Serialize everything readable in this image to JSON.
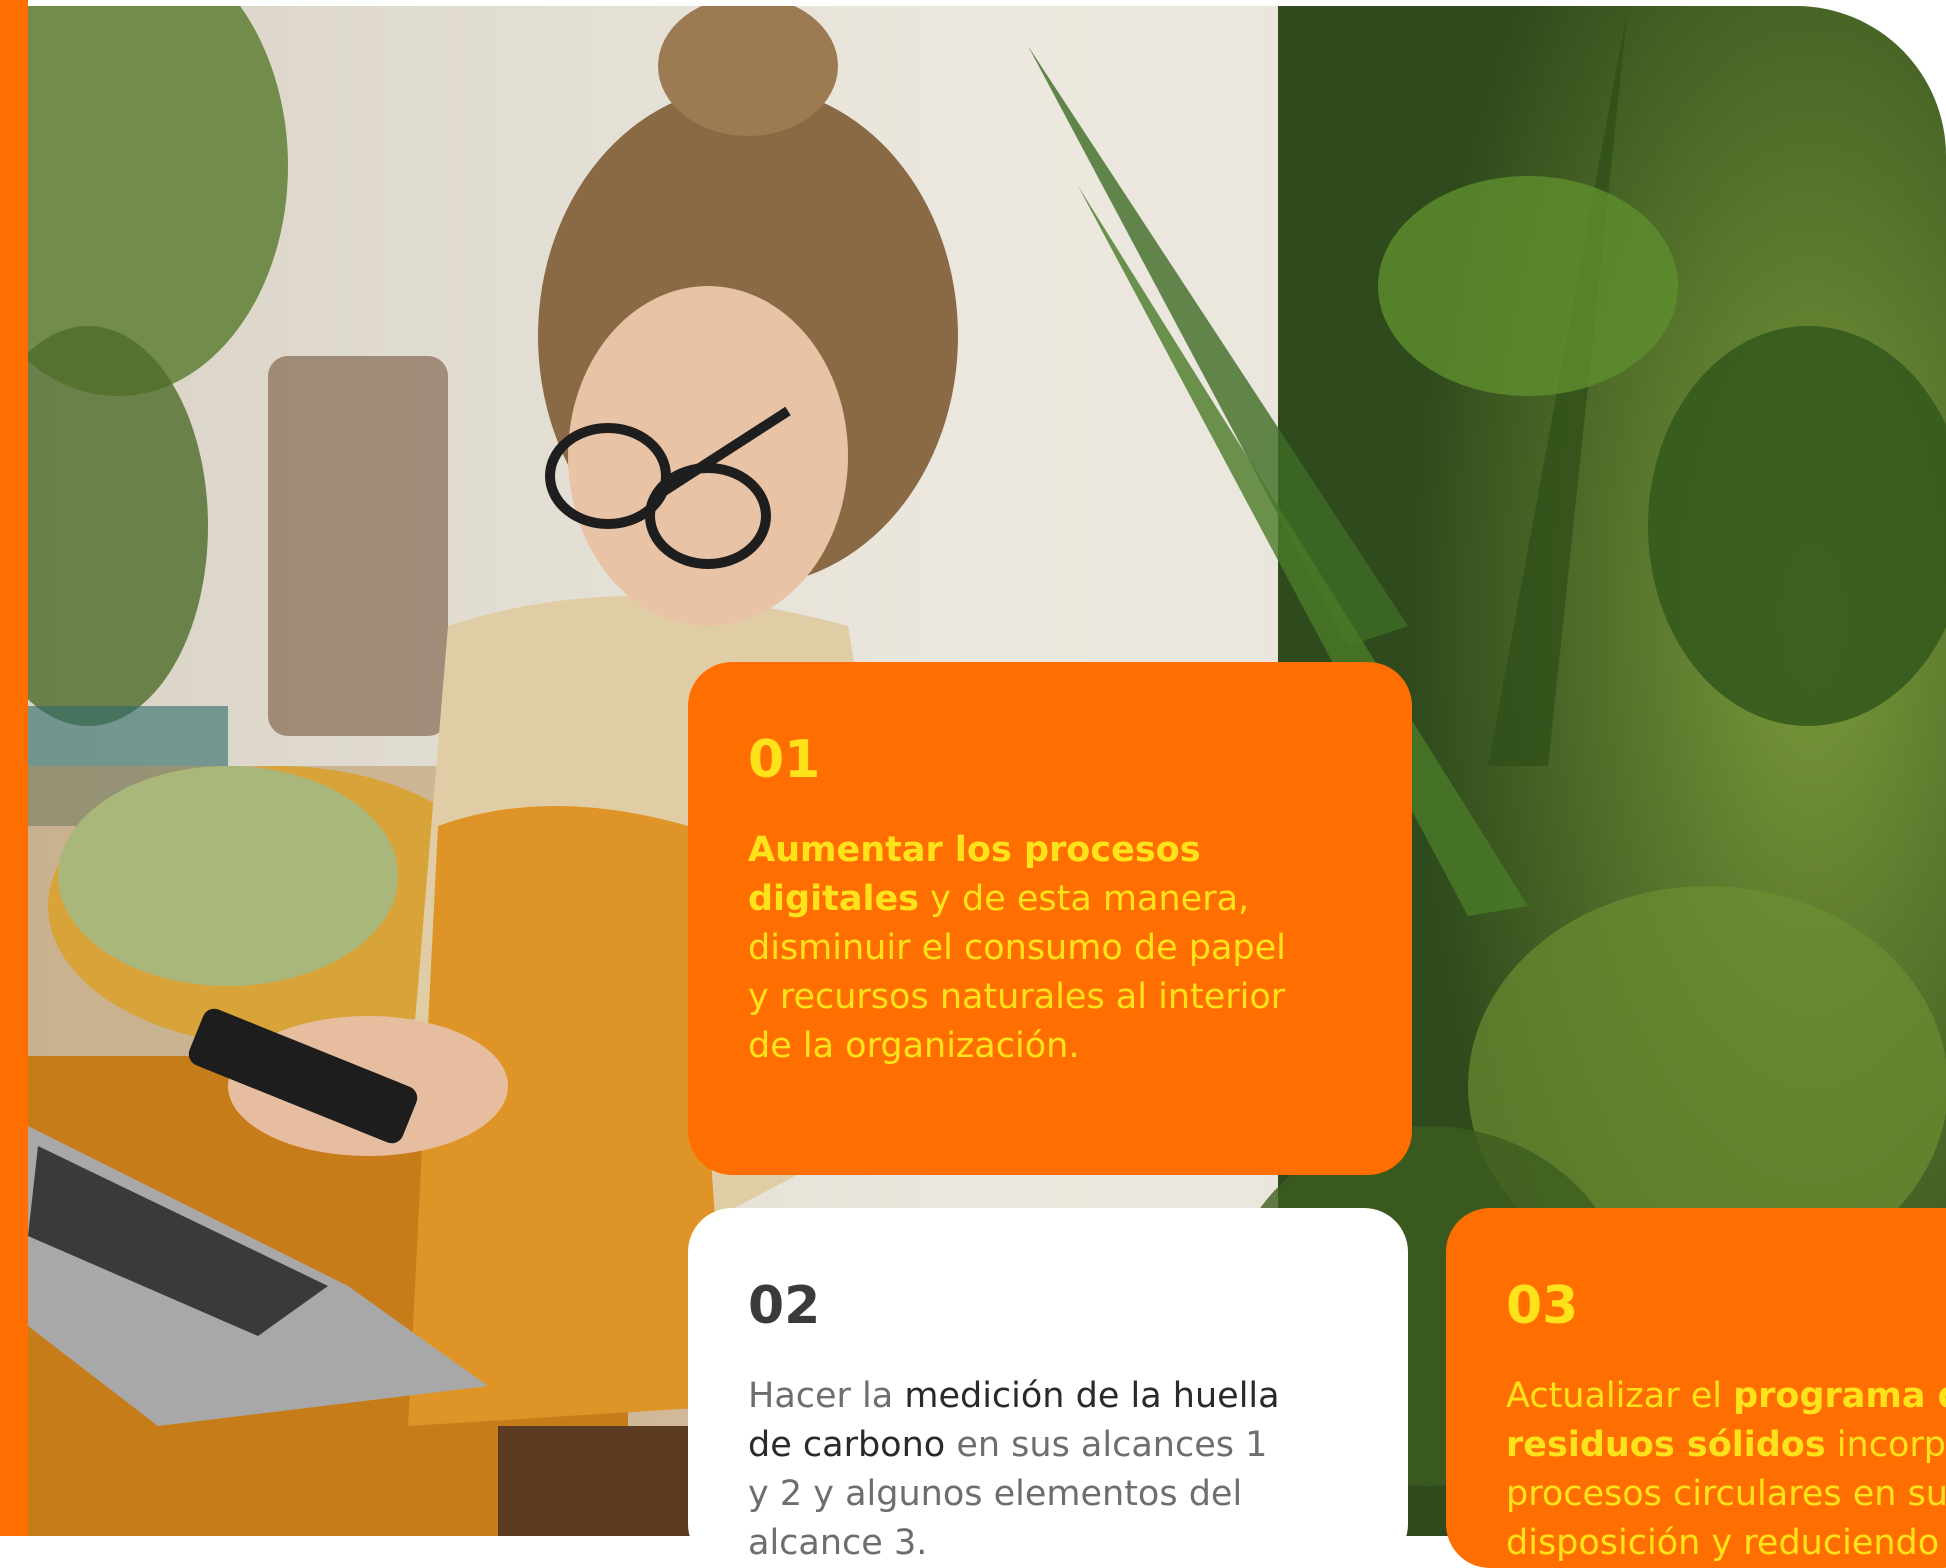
{
  "colors": {
    "accent_orange": "#FF6E00",
    "highlight_yellow": "#FFE31A",
    "card_white": "#FFFFFF",
    "dark_text": "#3A3A3A",
    "grey_text": "#6E6E6E"
  },
  "photo": {
    "subject": "woman-with-glasses-using-phone-and-laptop-among-plants"
  },
  "cards": [
    {
      "number": "01",
      "lines": [
        {
          "bold": "Aumentar los procesos",
          "rest": ""
        },
        {
          "bold": "digitales",
          "rest": " y de esta manera,"
        },
        {
          "bold": "",
          "rest": "disminuir el consumo de papel"
        },
        {
          "bold": "",
          "rest": "y recursos naturales al interior"
        },
        {
          "bold": "",
          "rest": "de la organización."
        }
      ]
    },
    {
      "number": "02",
      "lines": [
        {
          "pre": "Hacer la ",
          "bold": "medición de la huella",
          "rest": ""
        },
        {
          "pre": "",
          "bold": "de carbono",
          "rest": " en sus alcances 1"
        },
        {
          "pre": "",
          "bold": "",
          "rest": "y 2 y algunos elementos del"
        },
        {
          "pre": "",
          "bold": "",
          "rest": "alcance 3."
        }
      ]
    },
    {
      "number": "03",
      "lines": [
        {
          "pre": "Actualizar el ",
          "bold": "programa d",
          "rest": ""
        },
        {
          "pre": "",
          "bold": "residuos sólidos",
          "rest": " incorpor"
        },
        {
          "pre": "",
          "bold": "",
          "rest": "procesos circulares en su"
        },
        {
          "pre": "",
          "bold": "",
          "rest": "disposición y reduciendo"
        }
      ]
    }
  ]
}
